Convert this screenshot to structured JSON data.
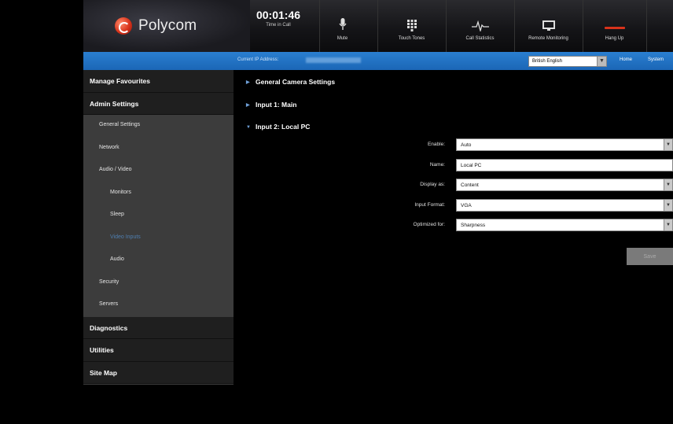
{
  "header": {
    "brand": "Polycom",
    "timer": {
      "value": "00:01:46",
      "label": "Time in Call"
    },
    "buttons": [
      {
        "label": "Mute",
        "icon": "microphone-icon"
      },
      {
        "label": "Touch Tones",
        "icon": "keypad-icon"
      },
      {
        "label": "Call Statistics",
        "icon": "statistics-icon"
      },
      {
        "label": "Remote Monitoring",
        "icon": "monitor-icon"
      },
      {
        "label": "Hang Up",
        "icon": "hang-up-icon"
      }
    ]
  },
  "addressbar": {
    "label": "Current IP Address:",
    "language": "British English",
    "links": [
      "Home",
      "System"
    ]
  },
  "sidebar": {
    "items": [
      {
        "label": "Manage Favourites",
        "level": 1
      },
      {
        "label": "Admin Settings",
        "level": 1
      },
      {
        "label": "General Settings",
        "level": 2
      },
      {
        "label": "Network",
        "level": 2
      },
      {
        "label": "Audio / Video",
        "level": 2
      },
      {
        "label": "Monitors",
        "level": 3
      },
      {
        "label": "Sleep",
        "level": 3
      },
      {
        "label": "Video Inputs",
        "level": 3,
        "active": true
      },
      {
        "label": "Audio",
        "level": 3
      },
      {
        "label": "Security",
        "level": 2
      },
      {
        "label": "Servers",
        "level": 2
      },
      {
        "label": "Diagnostics",
        "level": 1
      },
      {
        "label": "Utilities",
        "level": 1
      },
      {
        "label": "Site Map",
        "level": 1
      }
    ]
  },
  "main": {
    "sections": [
      {
        "label": "General Camera Settings",
        "expanded": false
      },
      {
        "label": "Input 1: Main",
        "expanded": false
      },
      {
        "label": "Input 2: Local PC",
        "expanded": true
      }
    ],
    "fields": [
      {
        "label": "Enable:",
        "value": "Auto",
        "type": "select"
      },
      {
        "label": "Name:",
        "value": "Local PC",
        "type": "text"
      },
      {
        "label": "Display as:",
        "value": "Content",
        "type": "select"
      },
      {
        "label": "Input Format:",
        "value": "VGA",
        "type": "select"
      },
      {
        "label": "Optimized for:",
        "value": "Sharpness",
        "type": "select"
      }
    ],
    "save_label": "Save"
  },
  "colors": {
    "accent_blue": "#1b66b6",
    "sidebar_bg": "#3c3c3c",
    "sidebar_header_bg": "#1f1f1f",
    "active_item": "#4f7fb0",
    "hang_up_red": "#d8331b"
  }
}
